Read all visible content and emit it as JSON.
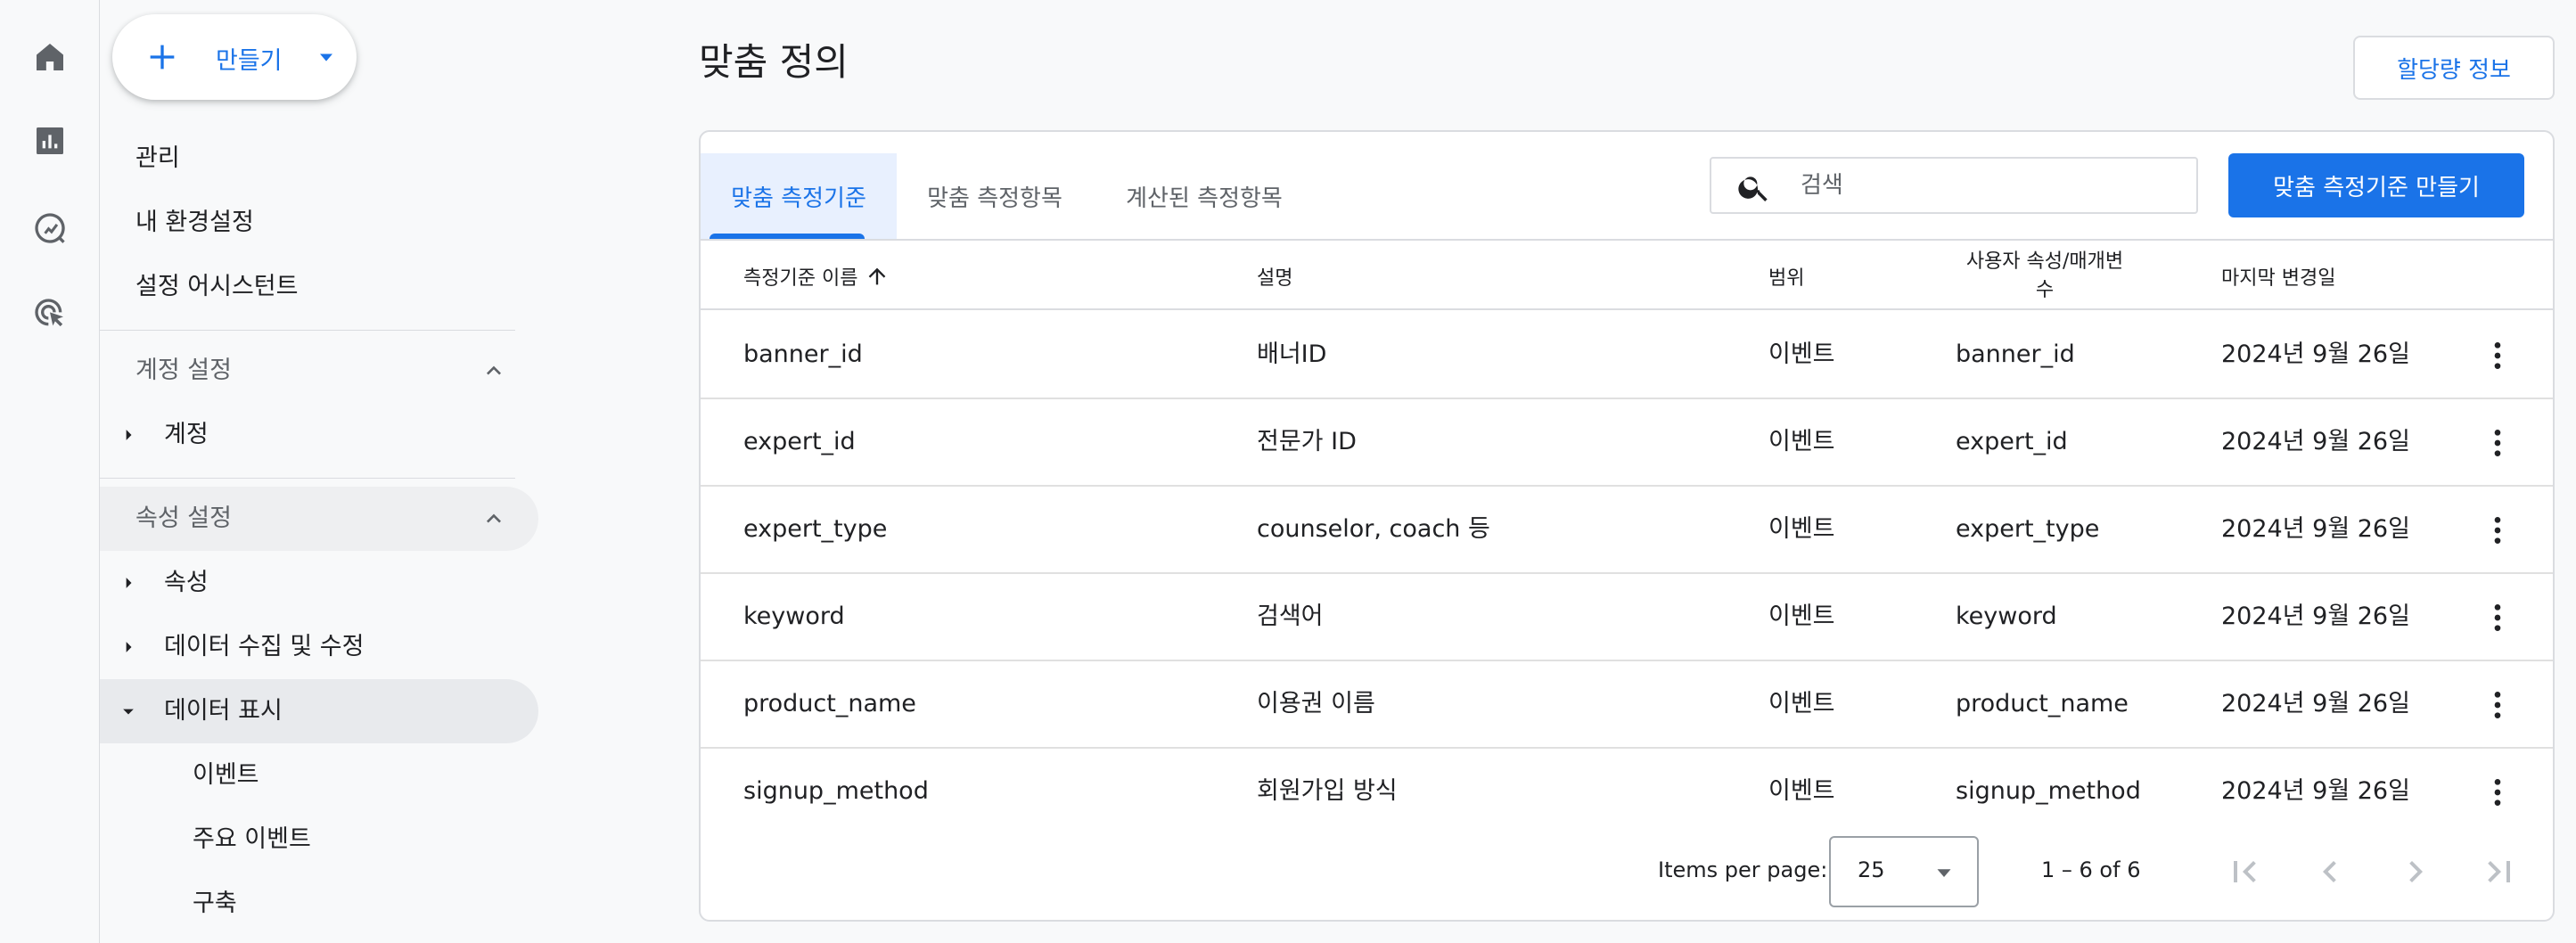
{
  "create": {
    "label": "만들기"
  },
  "nav": {
    "admin": "관리",
    "preferences": "내 환경설정",
    "setup_assistant": "설정 어시스턴트",
    "account_section": "계정 설정",
    "account": "계정",
    "property_section": "속성 설정",
    "property": "속성",
    "data_collection": "데이터 수집 및 수정",
    "data_display": "데이터 표시",
    "events": "이벤트",
    "key_events": "주요 이벤트",
    "audiences": "구축"
  },
  "page": {
    "title": "맞춤 정의",
    "quota_button": "할당량 정보"
  },
  "tabs": [
    {
      "label": "맞춤 측정기준",
      "active": true
    },
    {
      "label": "맞춤 측정항목",
      "active": false
    },
    {
      "label": "계산된 측정항목",
      "active": false
    }
  ],
  "search": {
    "placeholder": "검색"
  },
  "primary_button": "맞춤 측정기준 만들기",
  "table": {
    "headers": {
      "name": "측정기준 이름",
      "description": "설명",
      "scope": "범위",
      "user_property_line1": "사용자 속성/매개변",
      "user_property_line2": "수",
      "last_changed": "마지막 변경일"
    },
    "rows": [
      {
        "name": "banner_id",
        "description": "배너ID",
        "scope": "이벤트",
        "param": "banner_id",
        "date": "2024년 9월 26일"
      },
      {
        "name": "expert_id",
        "description": "전문가 ID",
        "scope": "이벤트",
        "param": "expert_id",
        "date": "2024년 9월 26일"
      },
      {
        "name": "expert_type",
        "description": "counselor, coach 등",
        "scope": "이벤트",
        "param": "expert_type",
        "date": "2024년 9월 26일"
      },
      {
        "name": "keyword",
        "description": "검색어",
        "scope": "이벤트",
        "param": "keyword",
        "date": "2024년 9월 26일"
      },
      {
        "name": "product_name",
        "description": "이용권 이름",
        "scope": "이벤트",
        "param": "product_name",
        "date": "2024년 9월 26일"
      },
      {
        "name": "signup_method",
        "description": "회원가입 방식",
        "scope": "이벤트",
        "param": "signup_method",
        "date": "2024년 9월 26일"
      }
    ]
  },
  "pager": {
    "items_label": "Items per page:",
    "items_value": "25",
    "range": "1 – 6 of 6"
  },
  "colors": {
    "accent": "#1a73e8",
    "active_tab_bg": "#e8f0fe",
    "nav_active_bg": "#e8eaed"
  },
  "icons": [
    "home-icon",
    "reports-icon",
    "explore-icon",
    "advertising-icon",
    "plus-icon",
    "search-icon",
    "more-vert-icon",
    "first-page-icon",
    "prev-page-icon",
    "next-page-icon",
    "last-page-icon"
  ]
}
